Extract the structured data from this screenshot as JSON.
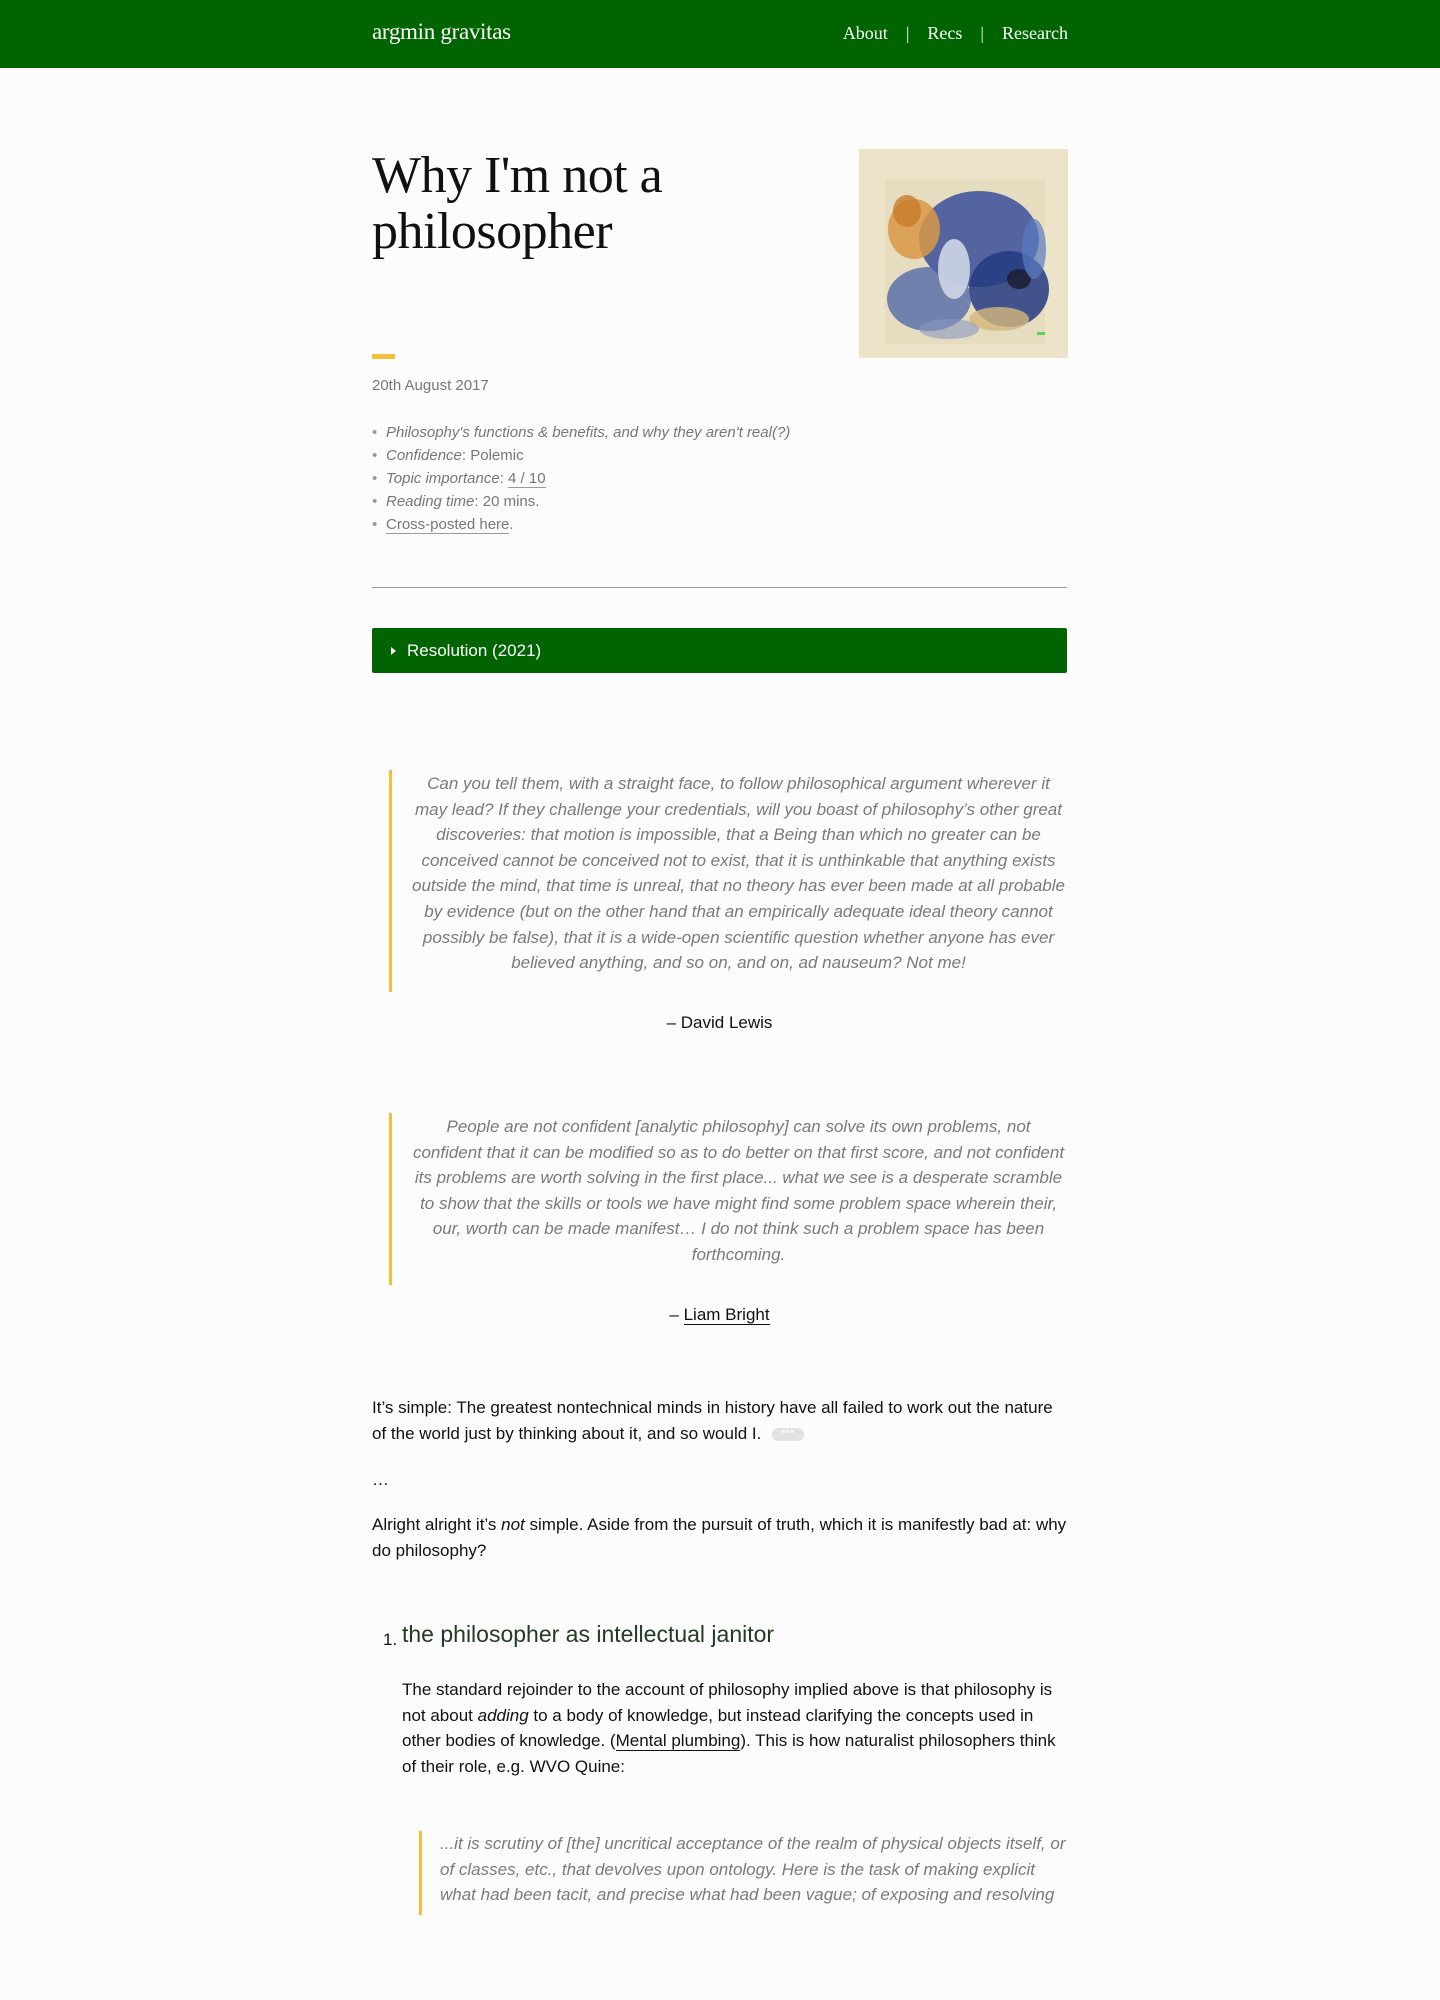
{
  "header": {
    "brand": "argmin gravitas",
    "nav": [
      "About",
      "Recs",
      "Research"
    ],
    "separator": "|"
  },
  "post": {
    "title": "Why I'm not a philosopher",
    "date": "20th August 2017",
    "meta": {
      "summary": "Philosophy's functions & benefits, and why they aren't real(?)",
      "confidence_label": "Confidence",
      "confidence_value": "Polemic",
      "importance_label": "Topic importance",
      "importance_value": "4 / 10",
      "reading_label": "Reading time",
      "reading_value": "20 mins.",
      "crosspost_link": "Cross-posted here",
      "crosspost_tail": "."
    },
    "resolution_label": "Resolution (2021)"
  },
  "quotes": [
    {
      "text": "Can you tell them, with a straight face, to follow philosophical argument wherever it may lead? If they challenge your credentials, will you boast of philosophy’s other great discoveries: that motion is impossible, that a Being than which no greater can be conceived cannot be conceived not to exist, that it is unthinkable that anything exists outside the mind, that time is unreal, that no theory has ever been made at all probable by evidence (but on the other hand that an empirically adequate ideal theory cannot possibly be false), that it is a wide-open scientific question whether anyone has ever believed anything, and so on, and on, ad nauseum? Not me!",
      "attribution": "– David Lewis"
    },
    {
      "text": "People are not confident [analytic philosophy] can solve its own problems, not confident that it can be modified so as to do better on that first score, and not confident its problems are worth solving in the first place... what we see is a desperate scramble to show that the skills or tools we have might find some problem space wherein their, our, worth can be made manifest… I do not think such a problem space has been forthcoming.",
      "attribution_prefix": "– ",
      "attribution_link": "Liam Bright"
    }
  ],
  "body": {
    "p1": "It’s simple: The greatest nontechnical minds in history have all failed to work out the nature of the world just by thinking about it, and so would I.",
    "ellipsis": "…",
    "p3_a": "Alright alright it’s ",
    "p3_em": "not",
    "p3_b": " simple. Aside from the pursuit of truth, which it is manifestly bad at: why do philosophy?",
    "section1": {
      "number": "1.",
      "title": "the philosopher as intellectual janitor",
      "p_a": "The standard rejoinder to the account of philosophy implied above is that philosophy is not about ",
      "p_em": "adding",
      "p_b": " to a body of knowledge, but instead clarifying the concepts used in other bodies of knowledge. (",
      "p_link": "Mental plumbing",
      "p_c": "). This is how naturalist philosophers think of their role, e.g. WVO Quine:",
      "quote": "...it is scrutiny of [the] uncritical acceptance of the realm of physical objects itself, or of classes, etc., that devolves upon ontology. Here is the task of making explicit what had been tacit, and precise what had been vague; of exposing and resolving"
    }
  },
  "colors": {
    "header_green": "#006400",
    "accent_yellow": "#f6bf3a",
    "quote_gray": "#7a7a7a"
  }
}
